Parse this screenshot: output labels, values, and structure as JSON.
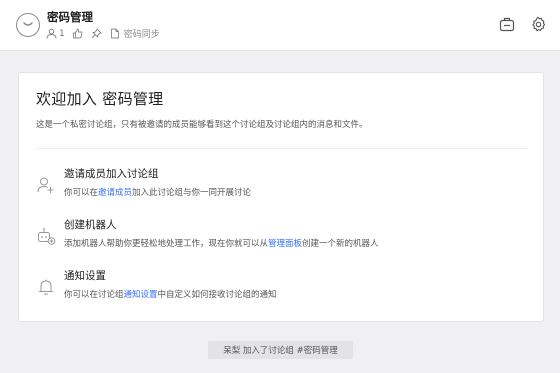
{
  "header": {
    "title": "密码管理",
    "member_count": "1",
    "description": "密码同步",
    "icons": {
      "avatar": "chevron-face-icon",
      "members": "person-icon",
      "thumb": "thumbs-up-icon",
      "pin": "pin-icon",
      "doc": "document-icon",
      "bag": "briefcase-icon",
      "settings": "gear-icon"
    }
  },
  "card": {
    "title": "欢迎加入 密码管理",
    "description": "这是一个私密讨论组，只有被邀请的成员能够看到这个讨论组及讨论组内的消息和文件。",
    "items": [
      {
        "title": "邀请成员加入讨论组",
        "desc_before": "你可以在",
        "link": "邀请成员",
        "desc_after": "加入此讨论组与你一同开展讨论"
      },
      {
        "title": "创建机器人",
        "desc_before": "添加机器人帮助你更轻松地处理工作，现在你就可以从",
        "link": "管理面板",
        "desc_after": "创建一个新的机器人"
      },
      {
        "title": "通知设置",
        "desc_before": "你可以在讨论组",
        "link": "通知设置",
        "desc_after": "中自定义如何接收讨论组的通知"
      }
    ]
  },
  "system_message": "呆梨 加入了讨论组 #密码管理",
  "colors": {
    "link": "#3370ff",
    "background": "#f0f0f2",
    "card": "#ffffff"
  }
}
